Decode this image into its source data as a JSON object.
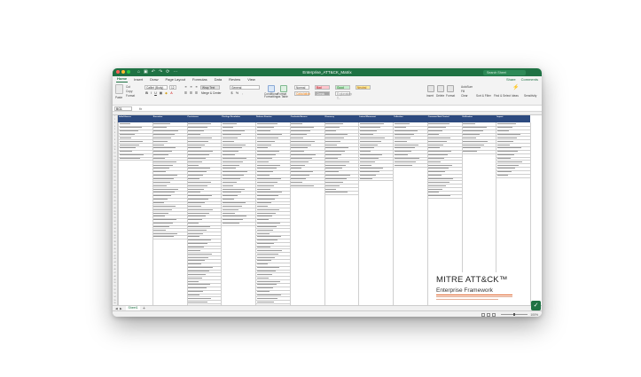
{
  "window": {
    "title": "Enterprise_ATT&CK_Matrix",
    "search_placeholder": "Search Sheet",
    "quick_access": [
      "⌂",
      "▣",
      "↶",
      "↷",
      "⟳",
      "⋯"
    ]
  },
  "tabs": [
    "Home",
    "Insert",
    "Draw",
    "Page Layout",
    "Formulas",
    "Data",
    "Review",
    "View"
  ],
  "tabs_right": [
    "Share",
    "Comments"
  ],
  "ribbon": {
    "paste_label": "Paste",
    "cut_label": "Cut",
    "copy_label": "Copy",
    "format_label": "Format",
    "font_name": "Calibri (Body)",
    "font_size": "12",
    "wrap_text": "Wrap Text",
    "merge_center": "Merge & Center",
    "number_format": "General",
    "cond_format": "Conditional Formatting",
    "format_table": "Format as Table",
    "styles": [
      {
        "label": "Normal",
        "color": "#ffffff",
        "text": "#333333"
      },
      {
        "label": "Bad",
        "color": "#ffc7ce",
        "text": "#9c0006"
      },
      {
        "label": "Good",
        "color": "#c6efce",
        "text": "#006100"
      },
      {
        "label": "Neutral",
        "color": "#ffeb9c",
        "text": "#9c5700"
      },
      {
        "label": "Calculation",
        "color": "#f2f2f2",
        "text": "#fa7d00"
      },
      {
        "label": "Check Cell",
        "color": "#a5a5a5",
        "text": "#ffffff"
      },
      {
        "label": "Explanatory T...",
        "color": "#ffffff",
        "text": "#7f7f7f"
      }
    ],
    "insert": "Insert",
    "delete": "Delete",
    "format": "Format",
    "autosum": "AutoSum",
    "fill": "Fill",
    "clear": "Clear",
    "sort_filter": "Sort & Filter",
    "find_select": "Find & Select",
    "ideas": "Ideas",
    "sensitivity": "Sensitivity"
  },
  "formula_bar": {
    "name_box": "BG1",
    "fx": "fx",
    "content": ""
  },
  "sheet": {
    "header_color": "#2d4a7f",
    "headers": [
      "Initial Access",
      "Execution",
      "Persistence",
      "Privilege Escalation",
      "Defense Evasion",
      "Credential Access",
      "Discovery",
      "Lateral Movement",
      "Collection",
      "Command And Control",
      "Exfiltration",
      "Impact"
    ],
    "column_counts": [
      11,
      34,
      58,
      30,
      62,
      19,
      21,
      17,
      13,
      22,
      9,
      16
    ]
  },
  "logo": {
    "title": "MITRE ATT&CK™",
    "subtitle": "Enterprise Framework"
  },
  "sheet_tabs": {
    "nav": [
      "◀",
      "▶"
    ],
    "active": "Sheet1",
    "add": "+"
  },
  "status": {
    "zoom": "100%"
  },
  "corner_badge": "✓"
}
